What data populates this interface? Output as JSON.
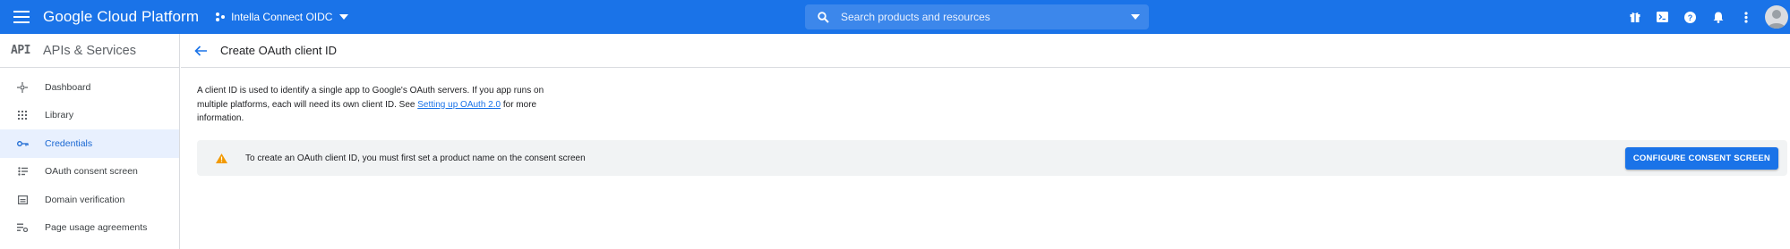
{
  "topbar": {
    "brand": "Google Cloud Platform",
    "project": "Intella Connect OIDC",
    "search_placeholder": "Search products and resources",
    "icons": [
      "gift-icon",
      "cloud-shell-icon",
      "help-icon",
      "notifications-icon",
      "more-vert-icon",
      "account-icon"
    ]
  },
  "sidebar": {
    "logo": "API",
    "title": "APIs & Services",
    "items": [
      {
        "label": "Dashboard",
        "icon": "dashboard-icon"
      },
      {
        "label": "Library",
        "icon": "library-icon"
      },
      {
        "label": "Credentials",
        "icon": "key-icon",
        "active": true
      },
      {
        "label": "OAuth consent screen",
        "icon": "consent-icon"
      },
      {
        "label": "Domain verification",
        "icon": "domain-icon"
      },
      {
        "label": "Page usage agreements",
        "icon": "settings-list-icon"
      }
    ]
  },
  "main": {
    "title": "Create OAuth client ID",
    "description_before": "A client ID is used to identify a single app to Google's OAuth servers. If you app runs on multiple platforms, each will need its own client ID. See ",
    "description_link": "Setting up OAuth 2.0",
    "description_after": " for more information.",
    "banner_text": "To create an OAuth client ID, you must first set a product name on the consent screen",
    "configure_button": "CONFIGURE CONSENT SCREEN"
  },
  "colors": {
    "topbar": "#1a73e8",
    "active_bg": "#e8f0fe",
    "active_text": "#1967d2",
    "warning": "#f29900"
  }
}
